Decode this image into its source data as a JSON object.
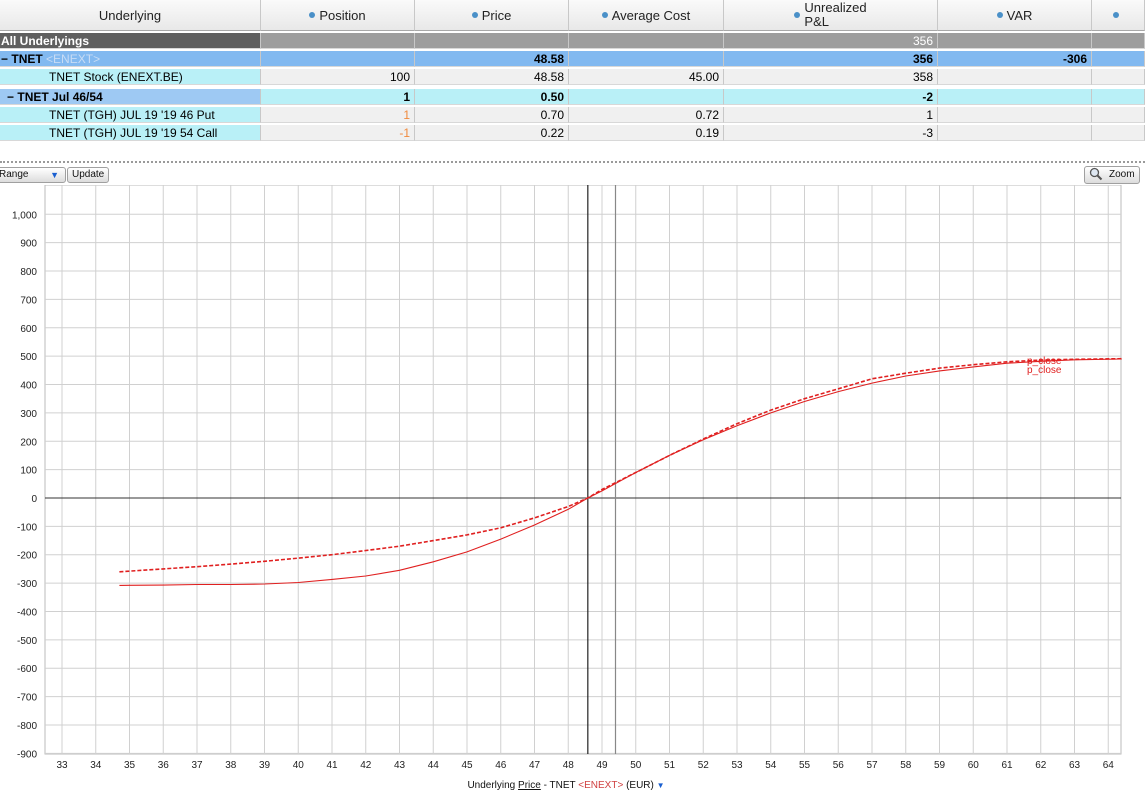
{
  "table": {
    "headers": {
      "underlying": "Underlying",
      "position": "Position",
      "price": "Price",
      "average_cost": "Average Cost",
      "unrealized_line1": "Unrealized",
      "unrealized_line2": "P&L",
      "var": "VAR"
    },
    "rows": {
      "all": {
        "label": "All Underlyings",
        "pnl": "356"
      },
      "tnet": {
        "toggle": "−",
        "label": "TNET",
        "exchange": "<ENEXT>",
        "price": "48.58",
        "pnl": "356",
        "var": "-306"
      },
      "stock": {
        "label": "TNET Stock (ENEXT.BE)",
        "position": "100",
        "price": "48.58",
        "avg_cost": "45.00",
        "pnl": "358"
      },
      "combo": {
        "toggle": "−",
        "label": "TNET Jul 46/54",
        "position": "1",
        "price": "0.50",
        "pnl": "-2"
      },
      "put": {
        "label": "TNET (TGH) JUL 19 '19 46 Put",
        "position": "1",
        "price": "0.70",
        "avg_cost": "0.72",
        "pnl": "1"
      },
      "call": {
        "label": "TNET (TGH) JUL 19 '19 54 Call",
        "position": "-1",
        "price": "0.22",
        "avg_cost": "0.19",
        "pnl": "-3"
      }
    }
  },
  "toolbar": {
    "range_label": "Range",
    "update_label": "Update",
    "zoom_label": "Zoom"
  },
  "chart_data": {
    "type": "line",
    "xlabel_prefix": "Underlying",
    "xlabel_word": "Price",
    "xlabel_symbol": "TNET",
    "xlabel_exchange": "<ENEXT>",
    "xlabel_currency": "(EUR)",
    "xlim": [
      32.5,
      64.5
    ],
    "ylim": [
      -900,
      1050
    ],
    "x_ticks": [
      33,
      34,
      35,
      36,
      37,
      38,
      39,
      40,
      41,
      42,
      43,
      44,
      45,
      46,
      47,
      48,
      49,
      50,
      51,
      52,
      53,
      54,
      55,
      56,
      57,
      58,
      59,
      60,
      61,
      62,
      63,
      64
    ],
    "y_ticks": [
      1000,
      900,
      800,
      700,
      600,
      500,
      400,
      300,
      200,
      100,
      0,
      -100,
      -200,
      -300,
      -400,
      -500,
      -600,
      -700,
      -800,
      -900
    ],
    "y_tick_labels": [
      "1,000",
      "900",
      "800",
      "700",
      "600",
      "500",
      "400",
      "300",
      "200",
      "100",
      "0",
      "-100",
      "-200",
      "-300",
      "-400",
      "-500",
      "-600",
      "-700",
      "-800",
      "-900"
    ],
    "reference_lines_x": [
      48.58,
      49.4
    ],
    "colors": {
      "series": "#e02020",
      "axis": "#333333",
      "grid": "#d0d0d0"
    },
    "series": [
      {
        "name": "p_close",
        "style": "solid",
        "x": [
          34.7,
          36,
          37,
          38,
          39,
          40,
          41,
          42,
          43,
          44,
          45,
          46,
          47,
          48,
          48.58,
          49,
          50,
          51,
          52,
          53,
          54,
          55,
          56,
          57,
          58,
          59,
          60,
          61,
          62,
          63,
          64.4
        ],
        "y": [
          -308,
          -307,
          -305,
          -305,
          -303,
          -298,
          -287,
          -275,
          -255,
          -225,
          -190,
          -145,
          -95,
          -40,
          0,
          25,
          90,
          150,
          205,
          255,
          300,
          340,
          375,
          405,
          430,
          448,
          462,
          475,
          482,
          487,
          490
        ]
      },
      {
        "name": "p_close",
        "style": "dashed",
        "x": [
          34.7,
          36,
          37,
          38,
          39,
          40,
          41,
          42,
          43,
          44,
          45,
          46,
          47,
          48,
          48.58,
          49,
          50,
          51,
          52,
          53,
          54,
          55,
          56,
          57,
          58,
          59,
          60,
          61,
          62,
          63,
          64.4
        ],
        "y": [
          -260,
          -250,
          -242,
          -233,
          -223,
          -212,
          -200,
          -185,
          -170,
          -150,
          -130,
          -105,
          -70,
          -30,
          0,
          30,
          90,
          150,
          208,
          262,
          310,
          350,
          385,
          420,
          440,
          458,
          470,
          480,
          486,
          489,
          491
        ]
      }
    ]
  }
}
